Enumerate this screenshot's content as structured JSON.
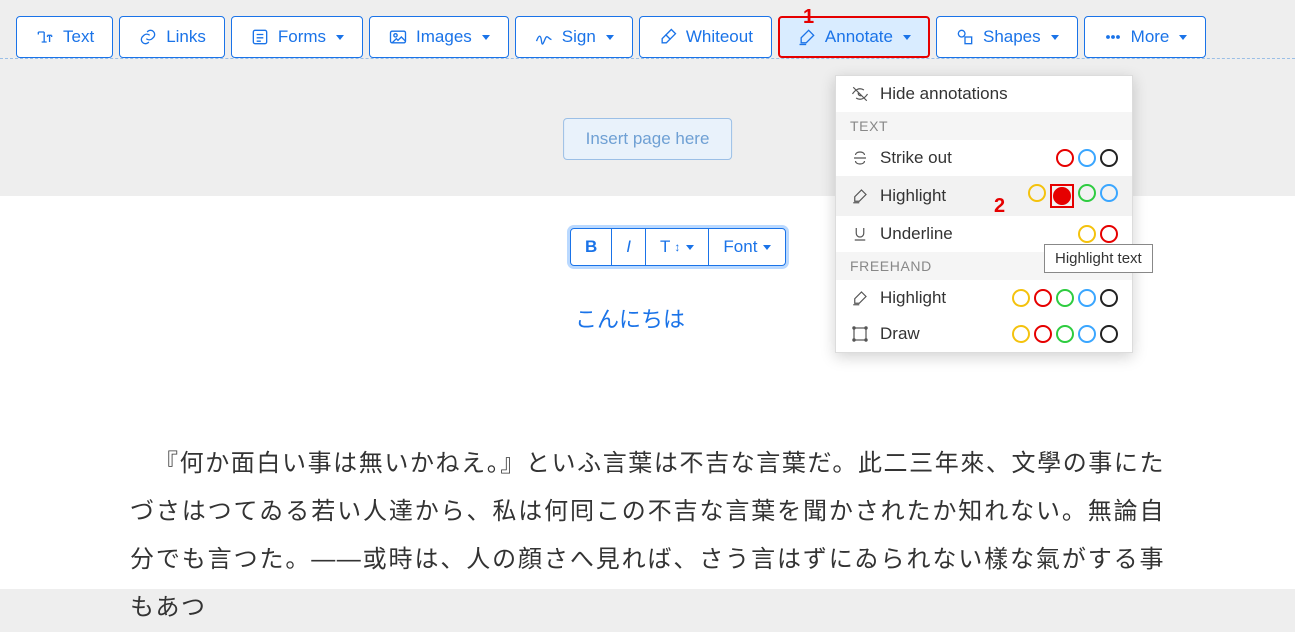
{
  "toolbar": {
    "text": "Text",
    "links": "Links",
    "forms": "Forms",
    "images": "Images",
    "sign": "Sign",
    "whiteout": "Whiteout",
    "annotate": "Annotate",
    "shapes": "Shapes",
    "more": "More"
  },
  "insert_page": "Insert page here",
  "edit_bar": {
    "bold": "B",
    "italic": "I",
    "size": "T",
    "font": "Font"
  },
  "greeting": "こんにちは",
  "body_text": "『何か面白い事は無いかねえ。』といふ言葉は不吉な言葉だ。此二三年來、文學の事にたづさはつてゐる若い人達から、私は何囘この不吉な言葉を聞かされたか知れない。無論自分でも言つた。——或時は、人の顔さへ見れば、さう言はずにゐられない樣な氣がする事もあつ",
  "dropdown": {
    "hide": "Hide annotations",
    "section_text": "TEXT",
    "strike": "Strike out",
    "highlight": "Highlight",
    "underline": "Underline",
    "section_freehand": "FREEHAND",
    "fh_highlight": "Highlight",
    "draw": "Draw"
  },
  "tooltip": "Highlight text",
  "callouts": {
    "c1": "1",
    "c2": "2"
  },
  "colors": {
    "yellow": "#f4c20d",
    "red": "#e60000",
    "green": "#2ecc40",
    "blue": "#3aa6ff",
    "black": "#222222"
  }
}
